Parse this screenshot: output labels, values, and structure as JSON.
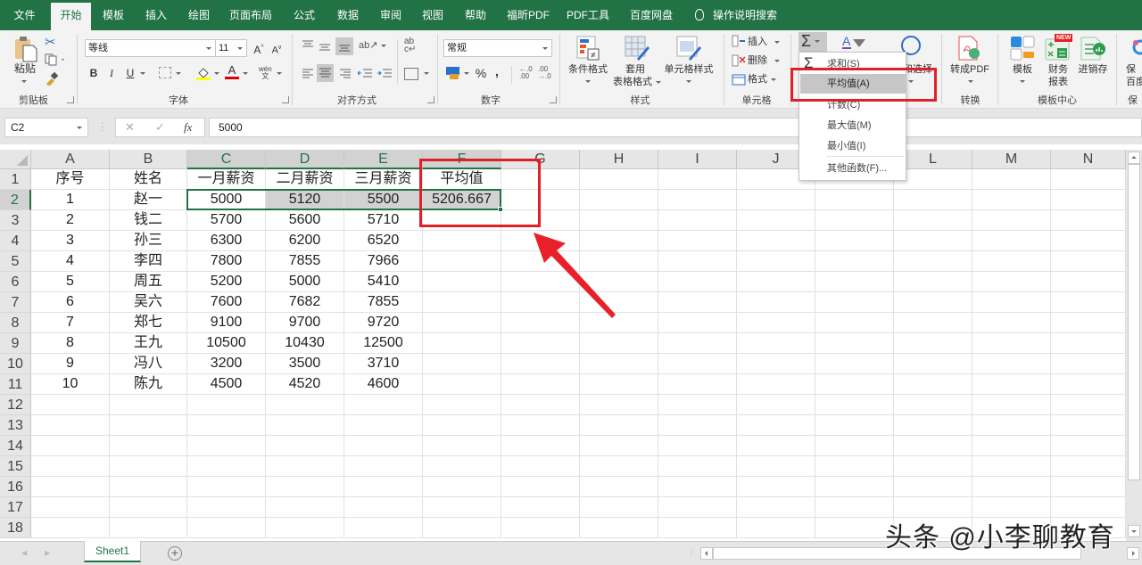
{
  "tabs": [
    {
      "label": "文件",
      "active": false
    },
    {
      "label": "开始",
      "active": true
    },
    {
      "label": "模板",
      "active": false
    },
    {
      "label": "插入",
      "active": false
    },
    {
      "label": "绘图",
      "active": false
    },
    {
      "label": "页面布局",
      "active": false
    },
    {
      "label": "公式",
      "active": false
    },
    {
      "label": "数据",
      "active": false
    },
    {
      "label": "审阅",
      "active": false
    },
    {
      "label": "视图",
      "active": false
    },
    {
      "label": "帮助",
      "active": false
    },
    {
      "label": "福昕PDF",
      "active": false
    },
    {
      "label": "PDF工具",
      "active": false
    },
    {
      "label": "百度网盘",
      "active": false
    }
  ],
  "search_tab": "操作说明搜索",
  "ribbon": {
    "clipboard": {
      "label": "剪贴板",
      "paste": "粘贴"
    },
    "font": {
      "label": "字体",
      "font_name": "等线",
      "font_size": "11",
      "bold": "B",
      "italic": "I",
      "underline": "U",
      "font_color": "A",
      "phonetic": "wén"
    },
    "alignment": {
      "label": "对齐方式"
    },
    "number": {
      "label": "数字",
      "format": "常规",
      "percent": "%",
      "comma": ","
    },
    "styles": {
      "label": "样式",
      "conditional": "条件格式",
      "table_line1": "套用",
      "table_line2": "表格格式",
      "cell_styles": "单元格样式"
    },
    "cells": {
      "label": "单元格",
      "insert": "插入",
      "delete": "删除",
      "format": "格式"
    },
    "editing": {
      "sigma": "Σ",
      "partial_label": "和选择"
    },
    "convert": {
      "label": "转换",
      "to_pdf": "转成PDF"
    },
    "templates": {
      "label": "模板中心",
      "template": "模板",
      "finance_line1": "财务",
      "finance_line2": "报表",
      "inventory": "进销存",
      "new_badge": "NEW"
    },
    "save": {
      "line1": "保",
      "line2": "百度",
      "label": "保"
    }
  },
  "autosum_menu": {
    "items": [
      {
        "label": "求和(S)",
        "icon": "sigma",
        "highlighted": false
      },
      {
        "label": "平均值(A)",
        "highlighted": true
      },
      {
        "label": "计数(C)",
        "highlighted": false
      },
      {
        "label": "最大值(M)",
        "highlighted": false
      },
      {
        "label": "最小值(I)",
        "highlighted": false
      },
      {
        "label": "其他函数(F)...",
        "highlighted": false
      }
    ]
  },
  "formula_bar": {
    "name_box": "C2",
    "cancel": "✕",
    "enter": "✓",
    "fx": "fx",
    "value": "5000"
  },
  "sheet": {
    "columns": [
      "A",
      "B",
      "C",
      "D",
      "E",
      "F",
      "G",
      "H",
      "I",
      "J",
      "K",
      "L",
      "M",
      "N"
    ],
    "selected_columns": [
      "C",
      "D",
      "E",
      "F"
    ],
    "row_numbers": [
      "1",
      "2",
      "3",
      "4",
      "5",
      "6",
      "7",
      "8",
      "9",
      "10",
      "11",
      "12",
      "13",
      "14",
      "15",
      "16",
      "17",
      "18"
    ],
    "selected_row": "2",
    "rows": [
      [
        "序号",
        "姓名",
        "一月薪资",
        "二月薪资",
        "三月薪资",
        "平均值"
      ],
      [
        "1",
        "赵一",
        "5000",
        "5120",
        "5500",
        "5206.667"
      ],
      [
        "2",
        "钱二",
        "5700",
        "5600",
        "5710",
        ""
      ],
      [
        "3",
        "孙三",
        "6300",
        "6200",
        "6520",
        ""
      ],
      [
        "4",
        "李四",
        "7800",
        "7855",
        "7966",
        ""
      ],
      [
        "5",
        "周五",
        "5200",
        "5000",
        "5410",
        ""
      ],
      [
        "6",
        "吴六",
        "7600",
        "7682",
        "7855",
        ""
      ],
      [
        "7",
        "郑七",
        "9100",
        "9700",
        "9720",
        ""
      ],
      [
        "8",
        "王九",
        "10500",
        "10430",
        "12500",
        ""
      ],
      [
        "9",
        "冯八",
        "3200",
        "3500",
        "3710",
        ""
      ],
      [
        "10",
        "陈九",
        "4500",
        "4520",
        "4600",
        ""
      ]
    ],
    "active_cell": "C2",
    "selection": "C2:F2"
  },
  "sheet_tabs": [
    {
      "label": "Sheet1",
      "active": true
    }
  ],
  "add_sheet": "+",
  "watermark": "头条 @小李聊教育",
  "colors": {
    "brand_green": "#217346",
    "annotation_red": "#e02027",
    "selection_gray": "#d2d2d2"
  }
}
